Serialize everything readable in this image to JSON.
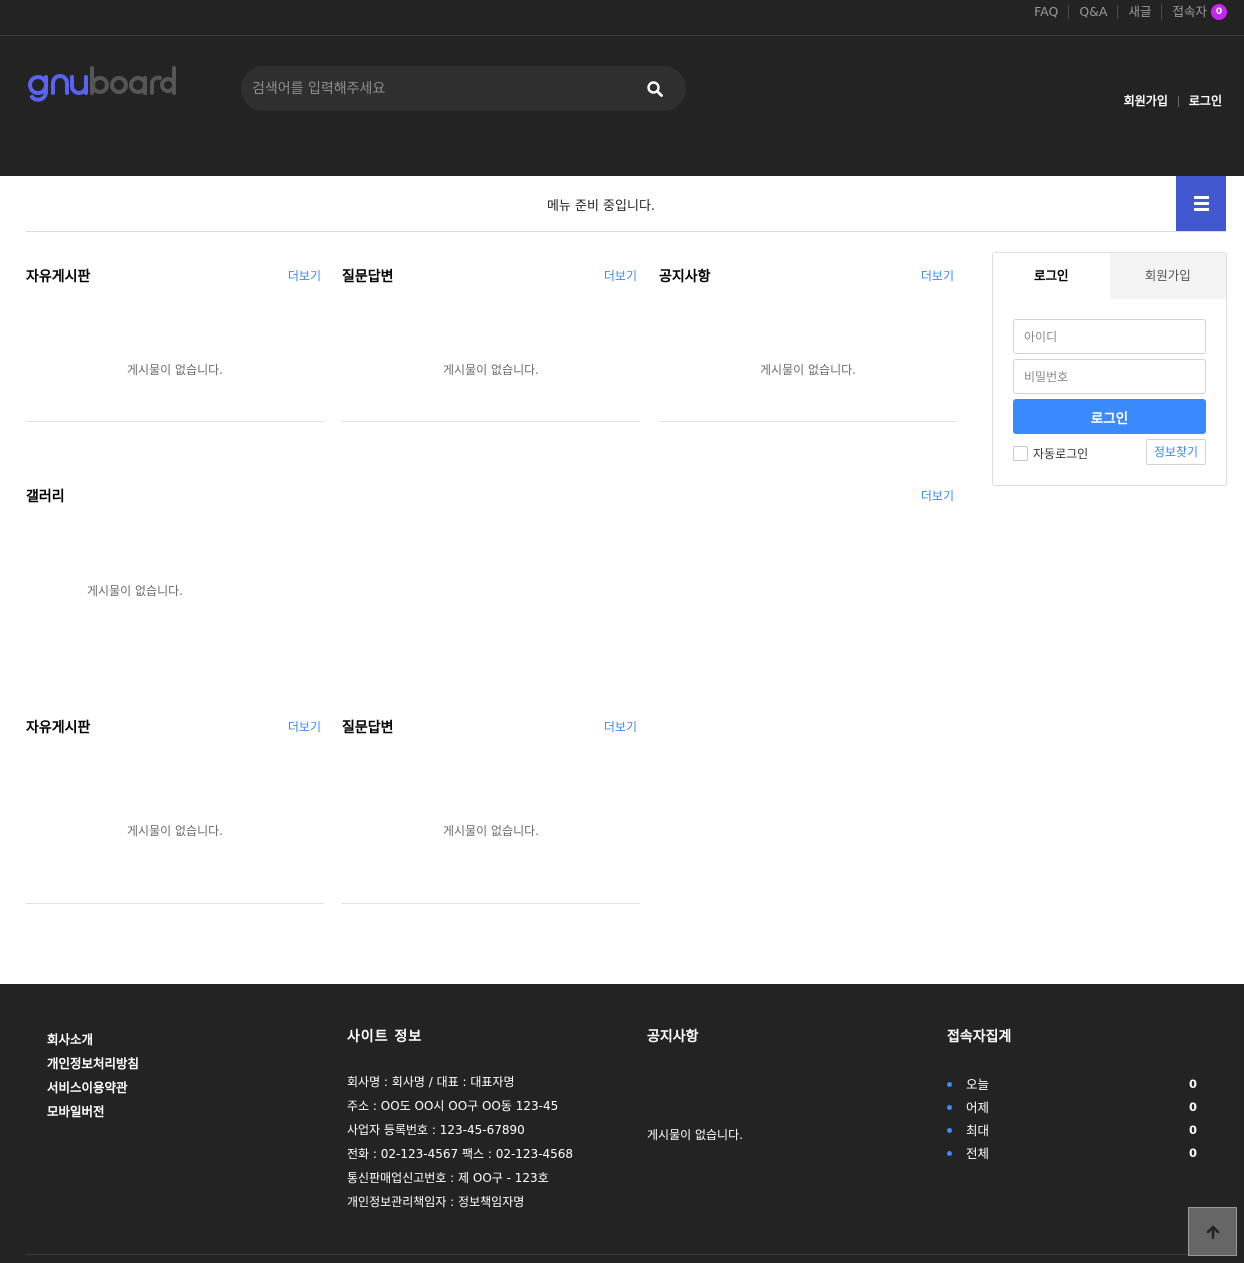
{
  "tnb": {
    "links": [
      "FAQ",
      "Q&A",
      "새글",
      "접속자"
    ],
    "visitor_count": "0"
  },
  "header": {
    "logo_text": "gnuboard",
    "search_placeholder": "검색어를 입력해주세요",
    "join_label": "회원가입",
    "login_label": "로그인"
  },
  "nav": {
    "message": "메뉴 준비 중입니다."
  },
  "latest": {
    "row1": [
      {
        "title": "자유게시판",
        "more": "더보기",
        "empty": "게시물이 없습니다."
      },
      {
        "title": "질문답변",
        "more": "더보기",
        "empty": "게시물이 없습니다."
      },
      {
        "title": "공지사항",
        "more": "더보기",
        "empty": "게시물이 없습니다."
      }
    ],
    "gallery": {
      "title": "갤러리",
      "more": "더보기",
      "empty": "게시물이 없습니다."
    },
    "row2": [
      {
        "title": "자유게시판",
        "more": "더보기",
        "empty": "게시물이 없습니다."
      },
      {
        "title": "질문답변",
        "more": "더보기",
        "empty": "게시물이 없습니다."
      }
    ]
  },
  "login_box": {
    "tab_login": "로그인",
    "tab_join": "회원가입",
    "id_placeholder": "아이디",
    "pw_placeholder": "비밀번호",
    "submit": "로그인",
    "auto_login": "자동로그인",
    "find_info": "정보찾기"
  },
  "footer": {
    "links": [
      "회사소개",
      "개인정보처리방침",
      "서비스이용약관",
      "모바일버전"
    ],
    "site_info": {
      "title": "사이트 정보",
      "lines": [
        "회사명 : 회사명 / 대표 : 대표자명",
        "주소 : OO도 OO시 OO구 OO동 123-45",
        "사업자 등록번호 : 123-45-67890",
        "전화 : 02-123-4567 팩스 : 02-123-4568",
        "통신판매업신고번호 : 제 OO구 - 123호",
        "개인정보관리책임자 : 정보책임자명"
      ]
    },
    "notice": {
      "title": "공지사항",
      "empty": "게시물이 없습니다."
    },
    "visit": {
      "title": "접속자집계",
      "items": [
        {
          "label": "오늘",
          "value": "0"
        },
        {
          "label": "어제",
          "value": "0"
        },
        {
          "label": "최대",
          "value": "0"
        },
        {
          "label": "전체",
          "value": "0"
        }
      ]
    }
  },
  "colors": {
    "dark_bg": "#232323",
    "accent_blue": "#3a8afd",
    "nav_button": "#4158d1",
    "badge": "#c825f4"
  }
}
